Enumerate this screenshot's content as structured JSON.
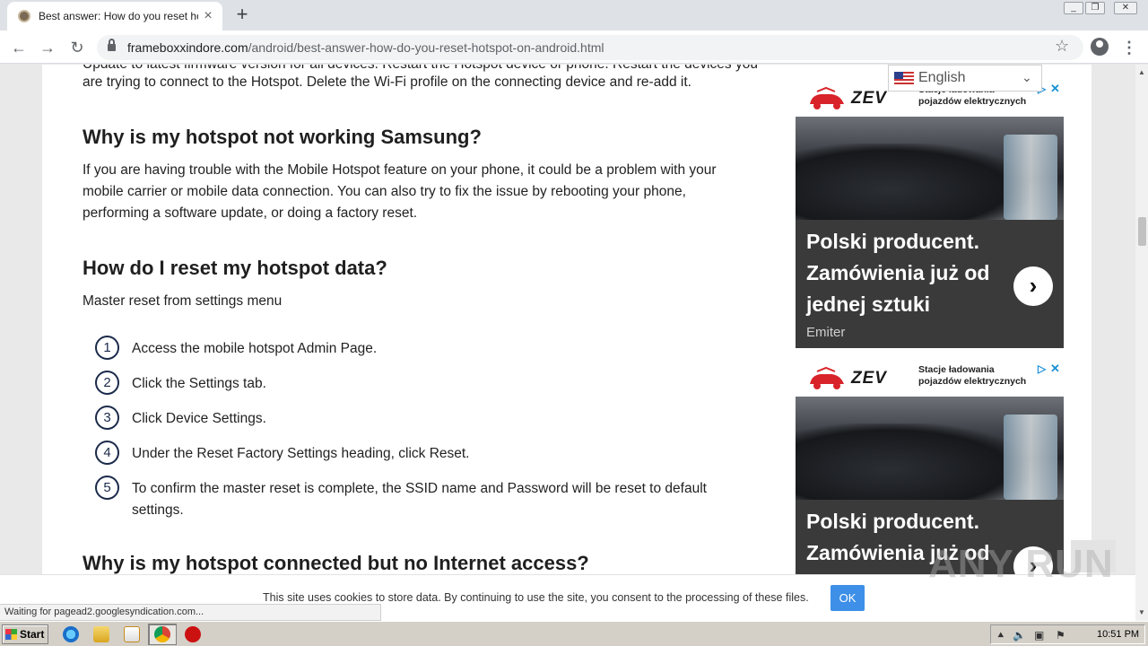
{
  "browser": {
    "tab_title": "Best answer: How do you reset hots",
    "tab_close": "×",
    "new_tab": "+",
    "url_host": "frameboxxindore.com",
    "url_path": "/android/best-answer-how-do-you-reset-hotspot-on-android.html",
    "status": "Waiting for pagead2.googlesyndication.com..."
  },
  "article": {
    "cut_line": "Update to latest firmware version for all devices. Restart the Hotspot device or phone. Restart the devices you",
    "intro_tail": "are trying to connect to the Hotspot. Delete the Wi-Fi profile on the connecting device and re-add it.",
    "heading1": "Why is my hotspot not working Samsung?",
    "para1": "If you are having trouble with the Mobile Hotspot feature on your phone, it could be a problem with your mobile carrier or mobile data connection. You can also try to fix the issue by rebooting your phone, performing a software update, or doing a factory reset.",
    "heading2": "How do I reset my hotspot data?",
    "para2": "Master reset from settings menu",
    "steps": [
      {
        "num": "1",
        "text": "Access the mobile hotspot Admin Page."
      },
      {
        "num": "2",
        "text": "Click the Settings tab."
      },
      {
        "num": "3",
        "text": "Click Device Settings."
      },
      {
        "num": "4",
        "text": "Under the Reset Factory Settings heading, click Reset."
      },
      {
        "num": "5",
        "text": "To confirm the master reset is complete, the SSID name and Password will be reset to default settings."
      }
    ],
    "heading3": "Why is my hotspot connected but no Internet access?"
  },
  "language": {
    "label": "English",
    "caret": "⌄"
  },
  "ads": [
    {
      "logo": "ZEV",
      "tagline": "Stacje ładowania pojazdów elektrycznych",
      "headline": "Polski producent. Zamówienia już od jednej sztuki",
      "brand": "Emiter",
      "arrow": "›"
    },
    {
      "logo": "ZEV",
      "tagline": "Stacje ładowania pojazdów elektrycznych",
      "headline": "Polski producent. Zamówienia już od",
      "arrow": "›"
    }
  ],
  "cookie": {
    "text": "This site uses cookies to store data. By continuing to use the site, you consent to the processing of these files.",
    "ok": "OK"
  },
  "watermark": "ANY RUN",
  "taskbar": {
    "start": "Start",
    "time": "10:51 PM"
  },
  "colors": {
    "accent": "#3d8fe8",
    "heading": "#1f1f1f",
    "ad_bg": "#3a3a3a",
    "step_ring": "#1b2a4a"
  }
}
